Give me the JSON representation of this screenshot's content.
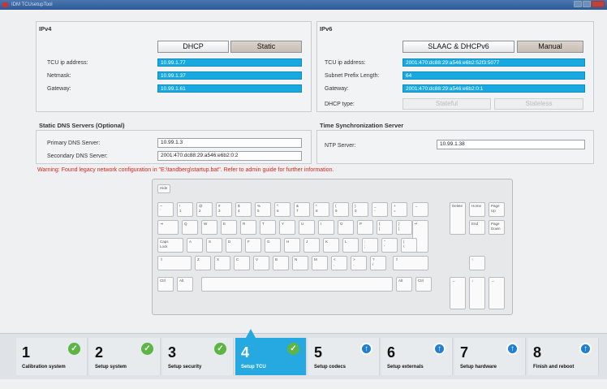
{
  "window": {
    "title": "IDM TCUsetupTool"
  },
  "ipv4": {
    "section": "IPv4",
    "dhcp_label": "DHCP",
    "static_label": "Static",
    "fields": [
      {
        "label": "TCU ip address:",
        "value": "10.99.1.77"
      },
      {
        "label": "Netmask:",
        "value": "10.99.1.37"
      },
      {
        "label": "Gateway:",
        "value": "10.99.1.61"
      }
    ]
  },
  "ipv6": {
    "section": "IPv6",
    "slaac_label": "SLAAC & DHCPv6",
    "manual_label": "Manual",
    "fields": [
      {
        "label": "TCU ip address:",
        "value": "2001:470:dc88:29:a546:e6b2:52f3:5077"
      },
      {
        "label": "Subnet Prefix Length:",
        "value": "64"
      },
      {
        "label": "Gateway:",
        "value": "2001:470:dc88:29:a546:e6b2:0:1"
      }
    ],
    "dhcp_type_label": "DHCP type:",
    "stateful_label": "Stateful",
    "stateless_label": "Stateless"
  },
  "dns": {
    "section": "Static DNS Servers (Optional)",
    "primary_label": "Primary DNS Server:",
    "primary_value": "10.99.1.3",
    "secondary_label": "Secondary DNS Server:",
    "secondary_value": "2001:470:dc88:29:a546:e6b2:0:2"
  },
  "time": {
    "section": "Time Synchronization Server",
    "ntp_label": "NTP Server:",
    "ntp_value": "10.99.1.38"
  },
  "warning": "Warning: Found legacy network configuration in \"E:\\tandberg\\startup.bat\". Refer to admin guide for further information.",
  "keyboard": {
    "hide": "Hide",
    "row1": [
      [
        "~",
        "`"
      ],
      [
        "!",
        "1"
      ],
      [
        "@",
        "2"
      ],
      [
        "#",
        "3"
      ],
      [
        "$",
        "4"
      ],
      [
        "%",
        "5"
      ],
      [
        "^",
        "6"
      ],
      [
        "&",
        "7"
      ],
      [
        "*",
        "8"
      ],
      [
        "(",
        "9"
      ],
      [
        ")",
        "0"
      ],
      [
        "_",
        "-"
      ],
      [
        "+",
        "="
      ]
    ],
    "row2": [
      "Q",
      "W",
      "E",
      "R",
      "T",
      "Y",
      "U",
      "I",
      "O",
      "P"
    ],
    "row2b": [
      [
        "{",
        "["
      ],
      [
        "}",
        "]"
      ]
    ],
    "row3": [
      "A",
      "S",
      "D",
      "F",
      "G",
      "H",
      "J",
      "K",
      "L"
    ],
    "row3b": [
      [
        ":",
        ";"
      ],
      [
        "\"",
        "'"
      ],
      [
        "|",
        "\\"
      ]
    ],
    "row4": [
      "Z",
      "X",
      "C",
      "V",
      "B",
      "N",
      "M"
    ],
    "row4b": [
      [
        "<",
        ","
      ],
      [
        ">",
        "."
      ],
      [
        "?",
        "/"
      ]
    ],
    "tab": "⇥",
    "backspace": "←",
    "enter": "↵",
    "caps": [
      "Caps",
      "Lock"
    ],
    "shift_l": "⇧",
    "shift_r": "⇧",
    "ctrl_l": "Ctrl",
    "alt_l": "Alt",
    "alt_r": "Alt",
    "ctrl_r": "Ctrl",
    "nav": {
      "delete": "Delete",
      "home": "Home",
      "pageup": [
        "Page",
        "Up"
      ],
      "end": "End",
      "pagedown": [
        "Page",
        "Down"
      ],
      "up": "↑",
      "left": "←",
      "down": "↓",
      "right": "→"
    }
  },
  "steps": [
    {
      "num": "1",
      "name": "Calibration system",
      "status": "check"
    },
    {
      "num": "2",
      "name": "Setup system",
      "status": "check"
    },
    {
      "num": "3",
      "name": "Setup security",
      "status": "check"
    },
    {
      "num": "4",
      "name": "Setup TCU",
      "status": "check",
      "active": true
    },
    {
      "num": "5",
      "name": "Setup codecs",
      "status": "arrow"
    },
    {
      "num": "6",
      "name": "Setup externals",
      "status": "arrow"
    },
    {
      "num": "7",
      "name": "Setup hardware",
      "status": "arrow"
    },
    {
      "num": "8",
      "name": "Finish and reboot",
      "status": "arrow"
    }
  ],
  "colors": {
    "field": "#19a9e1",
    "active_step": "#25a9e0",
    "check": "#5cb544",
    "arrow": "#1f7fd0",
    "warning": "#e2231a"
  }
}
